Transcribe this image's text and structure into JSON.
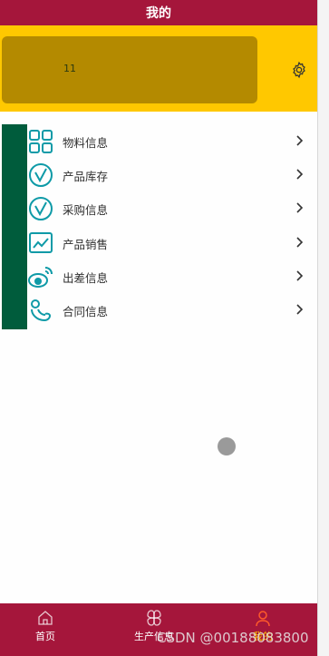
{
  "header": {
    "title": "我的"
  },
  "profile": {
    "number": "11",
    "settings_icon": "gear-icon"
  },
  "menu": {
    "items": [
      {
        "label": "物料信息",
        "icon": "grid-icon"
      },
      {
        "label": "产品库存",
        "icon": "check-circle-icon"
      },
      {
        "label": "采购信息",
        "icon": "check-circle-icon"
      },
      {
        "label": "产品销售",
        "icon": "chart-icon"
      },
      {
        "label": "出差信息",
        "icon": "weibo-icon"
      },
      {
        "label": "合同信息",
        "icon": "person-icon"
      }
    ]
  },
  "tabbar": {
    "tabs": [
      {
        "label": "首页",
        "icon": "home-icon",
        "active": false
      },
      {
        "label": "生产信息",
        "icon": "clover-icon",
        "active": false
      },
      {
        "label": "我的",
        "icon": "user-icon",
        "active": true
      }
    ]
  },
  "watermark": "CSDN @00188083800",
  "colors": {
    "brand": "#a5163b",
    "header_bg": "#ffc800",
    "card": "#b48a00",
    "accent": "#005c3c",
    "icon": "#0e9aa7"
  }
}
